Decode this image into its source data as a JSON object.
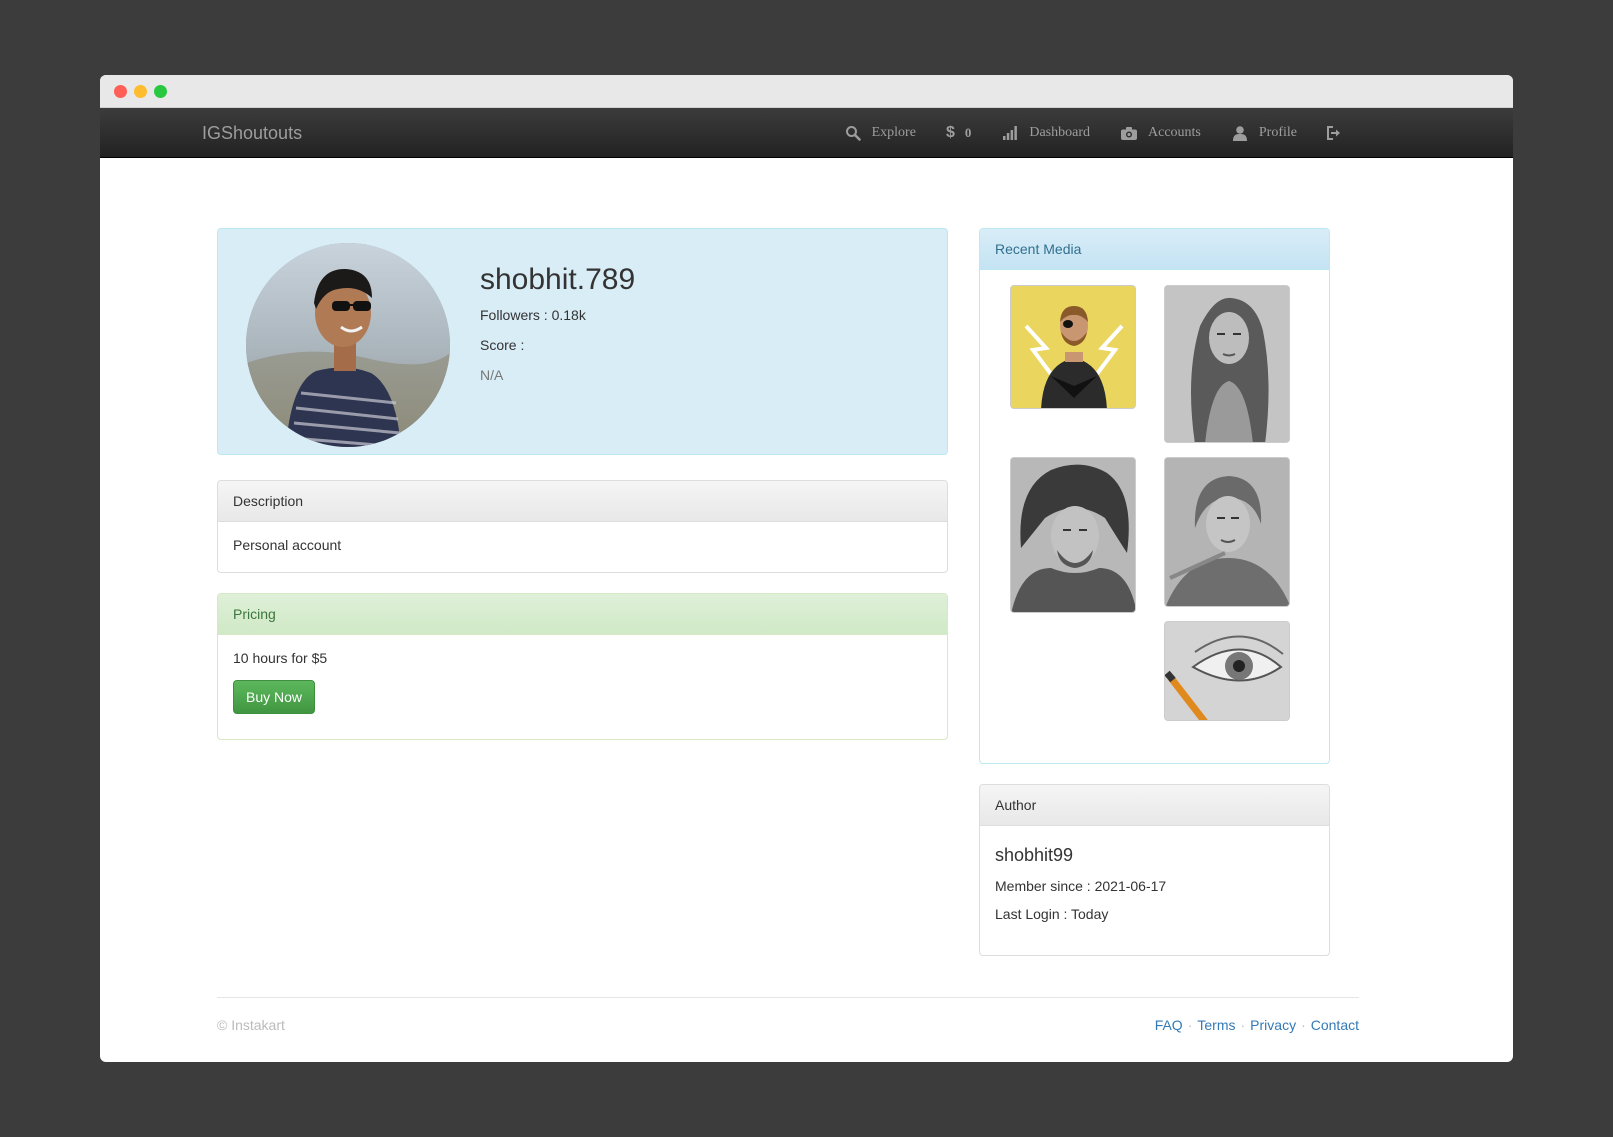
{
  "navbar": {
    "brand": "IGShoutouts",
    "items": [
      {
        "label": "Explore",
        "icon": "search-icon"
      },
      {
        "label": "0",
        "icon": "dollar-icon"
      },
      {
        "label": "Dashboard",
        "icon": "bar-chart-icon"
      },
      {
        "label": "Accounts",
        "icon": "camera-icon"
      },
      {
        "label": "Profile",
        "icon": "user-icon"
      },
      {
        "label": "",
        "icon": "logout-icon"
      }
    ],
    "dollar_symbol": "$"
  },
  "profile": {
    "username": "shobhit.789",
    "followers": "Followers : 0.18k",
    "score_label": "Score :",
    "score_value": "N/A"
  },
  "description": {
    "heading": "Description",
    "text": "Personal account"
  },
  "pricing": {
    "heading": "Pricing",
    "text": "10 hours for $5",
    "button": "Buy Now"
  },
  "recent_media": {
    "heading": "Recent Media"
  },
  "author": {
    "heading": "Author",
    "name": "shobhit99",
    "member_since": "Member since : 2021-06-17",
    "last_login": "Last Login : Today"
  },
  "footer": {
    "copyright": "© Instakart",
    "links": [
      "FAQ",
      "Terms",
      "Privacy",
      "Contact"
    ],
    "separator": "·"
  },
  "colors": {
    "background": "#3c3c3c",
    "navbar": "#222222",
    "info_panel": "#d9edf7",
    "success_button": "#5cb85c",
    "link": "#337ab7"
  }
}
